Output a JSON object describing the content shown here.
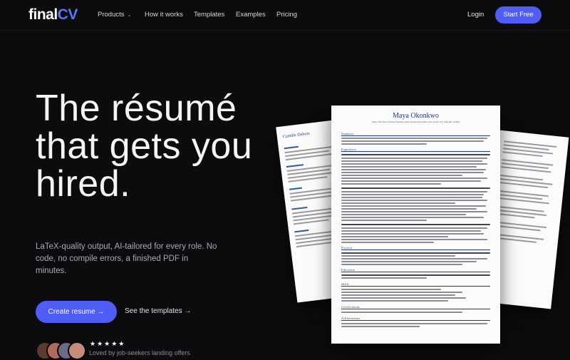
{
  "nav": {
    "logo_main": "final",
    "logo_accent": "CV",
    "items": [
      "Products",
      "How it works",
      "Templates",
      "Examples",
      "Pricing"
    ],
    "login": "Login",
    "cta": "Start Free"
  },
  "hero": {
    "headline": "The résumé that gets you hired.",
    "subtext": "LaTeX-quality output, AI-tailored for every role. No code, no compile errors, a finished PDF in minutes.",
    "primary_button": "Create resume →",
    "secondary_link": "See the templates →",
    "rating_stars": "★★★★★",
    "social_proof": "Loved by job-seekers landing offers"
  },
  "resume_main": {
    "name": "Maya Okonkwo",
    "tagline": "Senior Full-Stack Software Engineer | maya.okonkwo@example.com | Austin, TX | LinkedIn | GitHub",
    "sections": [
      "Summary",
      "Experience",
      "Projects",
      "Education",
      "Skills",
      "Certifications",
      "Achievements"
    ]
  },
  "resume_left": {
    "name": "Camille Dubois"
  },
  "colors": {
    "background": "#0c0c0e",
    "accent": "#4f5cf5",
    "logo_accent": "#5b74ff",
    "resume_heading": "#1d3a8a"
  }
}
